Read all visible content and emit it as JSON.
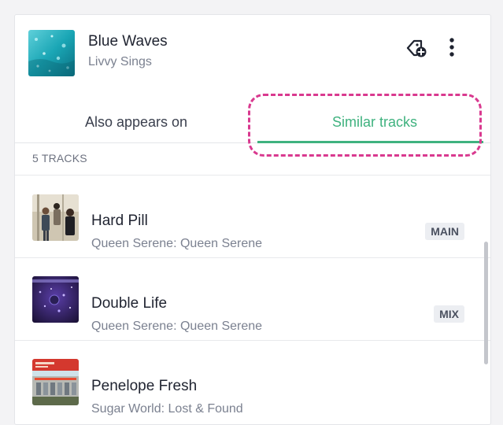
{
  "now_playing": {
    "title": "Blue Waves",
    "artist": "Livvy Sings"
  },
  "icons": {
    "tag": "tag-add-icon",
    "more": "more-vertical-icon"
  },
  "tabs": [
    {
      "label": "Also appears on",
      "active": false
    },
    {
      "label": "Similar tracks",
      "active": true
    }
  ],
  "track_count": "5 TRACKS",
  "tracks": [
    {
      "title": "Hard Pill",
      "subtitle": "Queen Serene: Queen Serene",
      "badge": "MAIN"
    },
    {
      "title": "Double Life",
      "subtitle": "Queen Serene: Queen Serene",
      "badge": "MIX"
    },
    {
      "title": "Penelope Fresh",
      "subtitle": "Sugar World: Lost & Found",
      "badge": ""
    }
  ],
  "colors": {
    "accent": "#3fb27f",
    "highlight": "#d9398f"
  }
}
